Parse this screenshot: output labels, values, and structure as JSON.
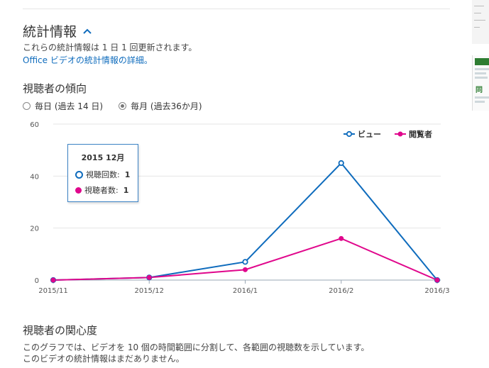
{
  "stats": {
    "title": "統計情報",
    "update_note": "これらの統計情報は 1 日 1 回更新されます。",
    "details_link": "Office ビデオの統計情報の詳細。"
  },
  "trend": {
    "title": "視聴者の傾向",
    "options": [
      {
        "label": "毎日 (過去 14 日)",
        "selected": false
      },
      {
        "label": "毎月 (過去36か月)",
        "selected": true
      }
    ]
  },
  "tooltip": {
    "title": "2015 12月",
    "rows": [
      {
        "label": "視聴回数:",
        "value": "1"
      },
      {
        "label": "視聴者数:",
        "value": "1"
      }
    ]
  },
  "chart_data": {
    "type": "line",
    "x": [
      "2015/11",
      "2015/12",
      "2016/1",
      "2016/2",
      "2016/3"
    ],
    "ylim": [
      0,
      60
    ],
    "yticks": [
      "0",
      "20",
      "40",
      "60"
    ],
    "series": [
      {
        "name": "ビュー",
        "color": "#0f6cbd",
        "marker": "hollow",
        "values": [
          0,
          1,
          7,
          45,
          0
        ]
      },
      {
        "name": "閲覧者",
        "color": "#e0078c",
        "marker": "filled",
        "values": [
          0,
          1,
          4,
          16,
          0
        ]
      }
    ],
    "legend_position": "top-right",
    "grid": true
  },
  "engagement": {
    "title": "視聴者の関心度",
    "desc": "このグラフでは、ビデオを 10 個の時間範囲に分割して、各範囲の視聴数を示しています。",
    "empty": "このビデオの統計情報はまだありません。"
  },
  "icons": {
    "collapse": "chevron-up-icon"
  }
}
